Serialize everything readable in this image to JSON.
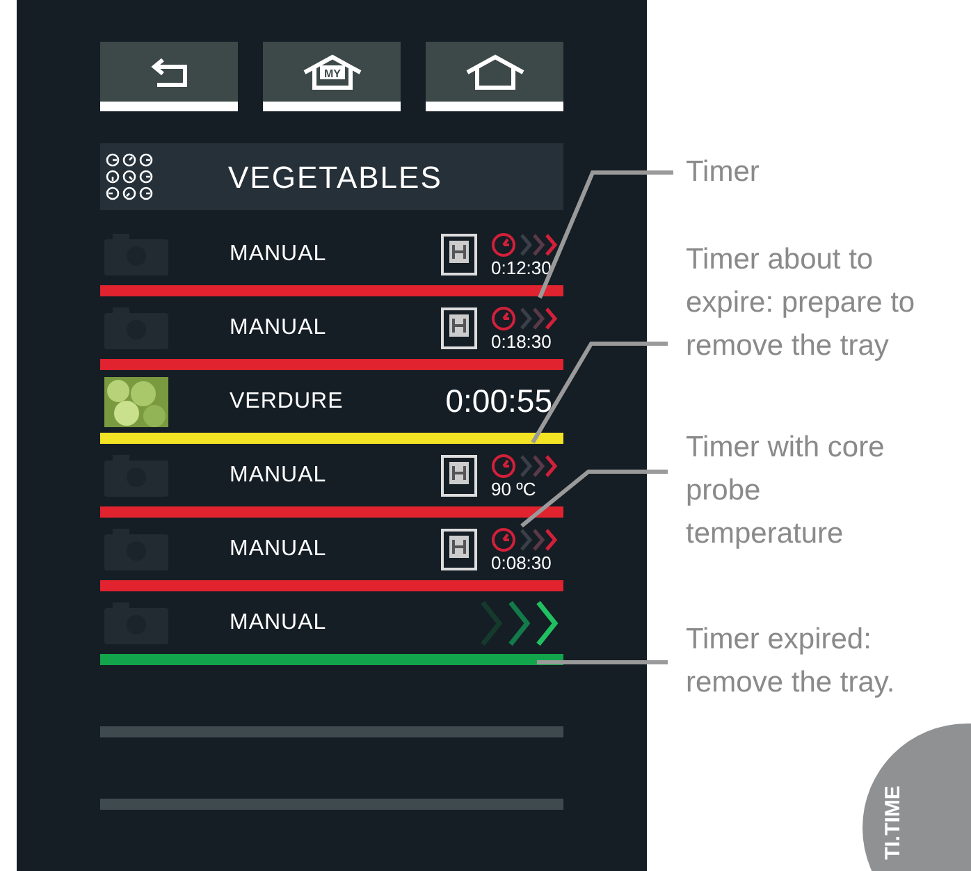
{
  "nav_buttons": [
    {
      "kind": "back"
    },
    {
      "kind": "my_home",
      "badge": "MY"
    },
    {
      "kind": "home"
    }
  ],
  "title": "VEGETABLES",
  "rows": [
    {
      "kind": "timer",
      "label": "MANUAL",
      "reading": "0:12:30",
      "color": "#e0232e"
    },
    {
      "kind": "timer",
      "label": "MANUAL",
      "reading": "0:18:30",
      "color": "#e0232e"
    },
    {
      "kind": "countdown",
      "label": "VERDURE",
      "reading": "0:00:55",
      "color": "#f2e424"
    },
    {
      "kind": "timer",
      "label": "MANUAL",
      "reading": "90 ºC",
      "color": "#e0232e"
    },
    {
      "kind": "timer",
      "label": "MANUAL",
      "reading": "0:08:30",
      "color": "#e0232e"
    },
    {
      "kind": "expired",
      "label": "MANUAL",
      "color": "#12a54c"
    }
  ],
  "empty_slots": [
    {
      "kind": "empty"
    },
    {
      "kind": "empty"
    }
  ],
  "callouts": [
    "Timer",
    "Timer about to expire: prepare to remove the tray",
    "Timer with core probe temperature",
    "Timer expired: remove the tray."
  ],
  "corner_tab": "TI.TIME"
}
